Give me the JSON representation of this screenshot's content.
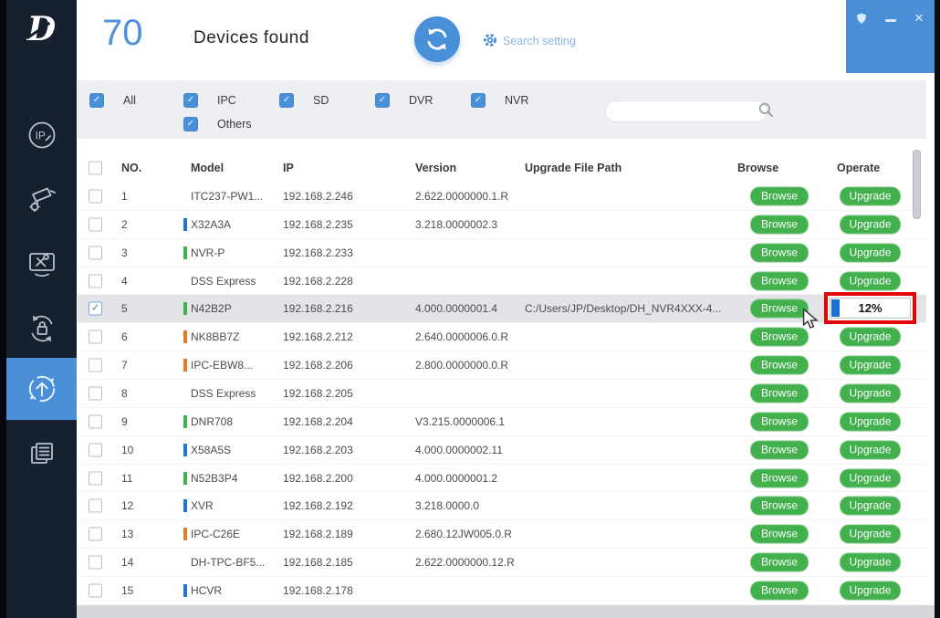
{
  "window": {
    "controls": {
      "theme_icon": "shield-icon",
      "minimize_icon": "minimize-icon",
      "close_icon": "close-icon",
      "close_glyph": "✕"
    }
  },
  "header": {
    "device_count": "70",
    "title": "Devices found",
    "refresh_icon": "refresh-sync-icon",
    "gear_icon": "gear-icon",
    "search_setting_label": "Search setting"
  },
  "filters": {
    "items": [
      {
        "key": "all",
        "label": "All",
        "checked": true
      },
      {
        "key": "ipc",
        "label": "IPC",
        "checked": true
      },
      {
        "key": "sd",
        "label": "SD",
        "checked": true
      },
      {
        "key": "dvr",
        "label": "DVR",
        "checked": true
      },
      {
        "key": "nvr",
        "label": "NVR",
        "checked": true
      },
      {
        "key": "others",
        "label": "Others",
        "checked": true
      }
    ]
  },
  "search": {
    "value": "",
    "placeholder": "",
    "icon": "search-magnifier-icon"
  },
  "table": {
    "headers": {
      "no": "NO.",
      "model": "Model",
      "ip": "IP",
      "version": "Version",
      "path": "Upgrade File Path",
      "browse": "Browse",
      "operate": "Operate"
    },
    "browse_label": "Browse",
    "upgrade_label": "Upgrade",
    "select_all_checked": false,
    "rows": [
      {
        "no": "1",
        "model": "ITC237-PW1...",
        "bar": "none",
        "ip": "192.168.2.246",
        "version": "2.622.0000000.1.R",
        "path": "",
        "checked": false,
        "selected": false,
        "operate": "upgrade"
      },
      {
        "no": "2",
        "model": "X32A3A",
        "bar": "blue",
        "ip": "192.168.2.235",
        "version": "3.218.0000002.3",
        "path": "",
        "checked": false,
        "selected": false,
        "operate": "upgrade"
      },
      {
        "no": "3",
        "model": "NVR-P",
        "bar": "green",
        "ip": "192.168.2.233",
        "version": "",
        "path": "",
        "checked": false,
        "selected": false,
        "operate": "upgrade"
      },
      {
        "no": "4",
        "model": "DSS Express",
        "bar": "none",
        "ip": "192.168.2.228",
        "version": "",
        "path": "",
        "checked": false,
        "selected": false,
        "operate": "upgrade"
      },
      {
        "no": "5",
        "model": "N42B2P",
        "bar": "green",
        "ip": "192.168.2.216",
        "version": "4.000.0000001.4",
        "path": "C:/Users/JP/Desktop/DH_NVR4XXX-4...",
        "checked": true,
        "selected": true,
        "operate": "progress",
        "progress": "12%"
      },
      {
        "no": "6",
        "model": "NK8BB7Z",
        "bar": "orange",
        "ip": "192.168.2.212",
        "version": "2.640.0000006.0.R",
        "path": "",
        "checked": false,
        "selected": false,
        "operate": "upgrade"
      },
      {
        "no": "7",
        "model": "IPC-EBW8...",
        "bar": "orange",
        "ip": "192.168.2.206",
        "version": "2.800.0000000.0.R",
        "path": "",
        "checked": false,
        "selected": false,
        "operate": "upgrade"
      },
      {
        "no": "8",
        "model": "DSS Express",
        "bar": "none",
        "ip": "192.168.2.205",
        "version": "",
        "path": "",
        "checked": false,
        "selected": false,
        "operate": "upgrade"
      },
      {
        "no": "9",
        "model": "DNR708",
        "bar": "green",
        "ip": "192.168.2.204",
        "version": "V3.215.0000006.1",
        "path": "",
        "checked": false,
        "selected": false,
        "operate": "upgrade"
      },
      {
        "no": "10",
        "model": "X58A5S",
        "bar": "blue",
        "ip": "192.168.2.203",
        "version": "4.000.0000002.11",
        "path": "",
        "checked": false,
        "selected": false,
        "operate": "upgrade"
      },
      {
        "no": "11",
        "model": "N52B3P4",
        "bar": "green",
        "ip": "192.168.2.200",
        "version": "4.000.0000001.2",
        "path": "",
        "checked": false,
        "selected": false,
        "operate": "upgrade"
      },
      {
        "no": "12",
        "model": "XVR",
        "bar": "blue",
        "ip": "192.168.2.192",
        "version": "3.218.0000.0",
        "path": "",
        "checked": false,
        "selected": false,
        "operate": "upgrade"
      },
      {
        "no": "13",
        "model": "IPC-C26E",
        "bar": "orange",
        "ip": "192.168.2.189",
        "version": "2.680.12JW005.0.R",
        "path": "",
        "checked": false,
        "selected": false,
        "operate": "upgrade"
      },
      {
        "no": "14",
        "model": "DH-TPC-BF5...",
        "bar": "none",
        "ip": "192.168.2.185",
        "version": "2.622.0000000.12.R",
        "path": "",
        "checked": false,
        "selected": false,
        "operate": "upgrade"
      },
      {
        "no": "15",
        "model": "HCVR",
        "bar": "blue",
        "ip": "192.168.2.178",
        "version": "",
        "path": "",
        "checked": false,
        "selected": false,
        "operate": "upgrade"
      }
    ]
  },
  "sidebar": {
    "logo": "D",
    "items": [
      {
        "key": "ip",
        "icon": "ip-circle-icon",
        "active": false
      },
      {
        "key": "camera-config",
        "icon": "camera-gear-icon",
        "active": false
      },
      {
        "key": "device-tools",
        "icon": "monitor-tools-icon",
        "active": false
      },
      {
        "key": "security",
        "icon": "sync-lock-icon",
        "active": false
      },
      {
        "key": "upgrade",
        "icon": "sync-up-arrow-icon",
        "active": true
      },
      {
        "key": "device-list",
        "icon": "documents-icon",
        "active": false
      }
    ]
  },
  "colors": {
    "accent_blue": "#4a90d9",
    "sidebar_navy": "#16202e",
    "button_green": "#42b04d",
    "annotation_red": "#e60505",
    "bar_blue": "#1e78d2",
    "bar_green": "#3cb44a",
    "bar_orange": "#e07d26",
    "selected_row": "#e3e4e8",
    "filter_bar_bg": "#edeff3"
  }
}
